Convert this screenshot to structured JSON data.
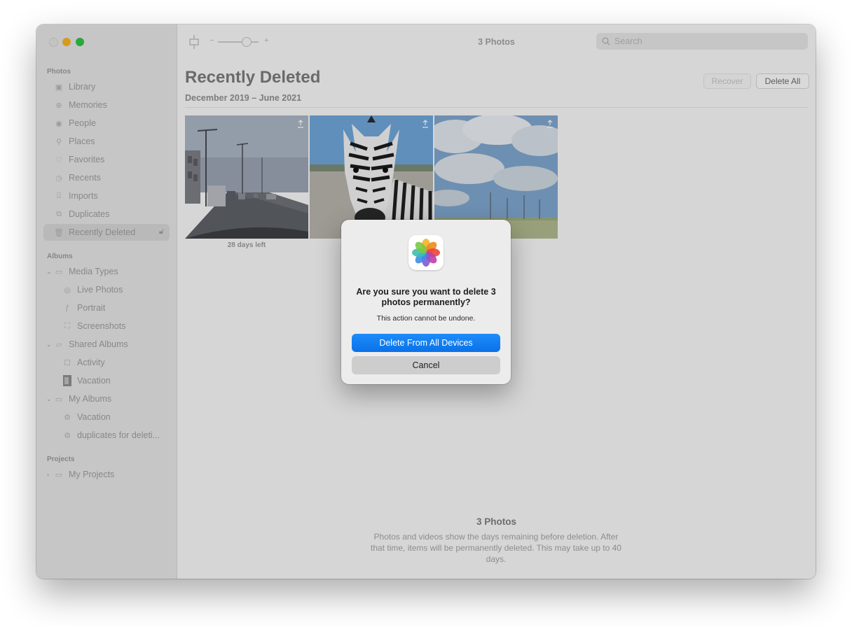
{
  "window": {
    "toolbar_title": "3 Photos",
    "search_placeholder": "Search"
  },
  "sidebar": {
    "photos_header": "Photos",
    "photos_items": [
      {
        "label": "Library",
        "icon": "library-icon"
      },
      {
        "label": "Memories",
        "icon": "memories-icon"
      },
      {
        "label": "People",
        "icon": "people-icon"
      },
      {
        "label": "Places",
        "icon": "places-icon"
      },
      {
        "label": "Favorites",
        "icon": "heart-icon"
      },
      {
        "label": "Recents",
        "icon": "clock-icon"
      },
      {
        "label": "Imports",
        "icon": "import-icon"
      },
      {
        "label": "Duplicates",
        "icon": "duplicates-icon"
      },
      {
        "label": "Recently Deleted",
        "icon": "trash-icon",
        "selected": true
      }
    ],
    "albums_header": "Albums",
    "album_items": [
      {
        "label": "Media Types",
        "icon": "folder-icon",
        "expanded": true
      },
      {
        "label": "Live Photos",
        "icon": "live-photo-icon"
      },
      {
        "label": "Portrait",
        "icon": "portrait-icon"
      },
      {
        "label": "Screenshots",
        "icon": "screenshot-icon"
      },
      {
        "label": "Shared Albums",
        "icon": "shared-albums-icon",
        "expanded": true
      },
      {
        "label": "Activity",
        "icon": "activity-icon"
      },
      {
        "label": "Vacation",
        "icon": "album-thumbnail-icon"
      },
      {
        "label": "My Albums",
        "icon": "folder-icon",
        "expanded": true
      },
      {
        "label": "Vacation",
        "icon": "smart-album-icon"
      },
      {
        "label": "duplicates for deleti...",
        "icon": "smart-album-icon"
      }
    ],
    "projects_header": "Projects",
    "project_items": [
      {
        "label": "My Projects",
        "icon": "folder-icon",
        "expanded": false
      }
    ]
  },
  "main": {
    "title": "Recently Deleted",
    "date_range": "December 2019 – June 2021",
    "recover_label": "Recover",
    "delete_all_label": "Delete All",
    "photos": [
      {
        "days_left": "28 days left",
        "subject": "highway traffic"
      },
      {
        "days_left": "",
        "subject": "zebra"
      },
      {
        "days_left": "ft",
        "subject": "field with clouds and wind turbines"
      }
    ],
    "footer_title": "3 Photos",
    "footer_text": "Photos and videos show the days remaining before deletion. After that time, items will be permanently deleted. This may take up to 40 days."
  },
  "dialog": {
    "icon": "photos-app-icon",
    "title": "Are you sure you want to delete 3 photos permanently?",
    "message": "This action cannot be undone.",
    "primary_label": "Delete From All Devices",
    "cancel_label": "Cancel"
  },
  "colors": {
    "accent": "#0a72e8",
    "close": "#e0e0e0",
    "minimize": "#f5b324",
    "maximize": "#31c146"
  }
}
